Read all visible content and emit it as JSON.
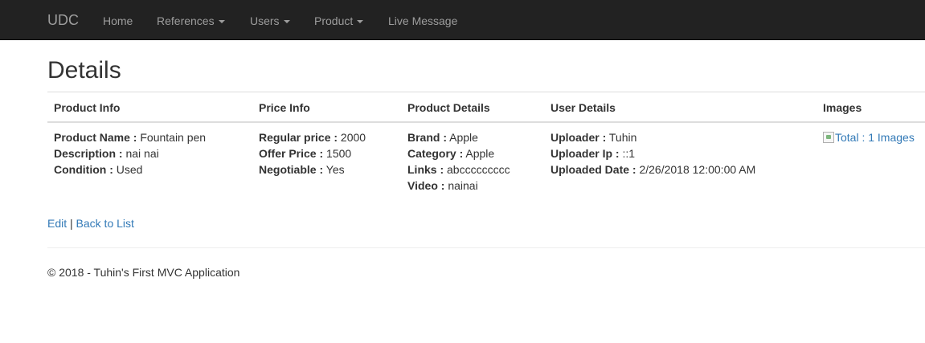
{
  "navbar": {
    "brand": "UDC",
    "items": [
      {
        "label": "Home",
        "dropdown": false
      },
      {
        "label": "References",
        "dropdown": true
      },
      {
        "label": "Users",
        "dropdown": true
      },
      {
        "label": "Product",
        "dropdown": true
      },
      {
        "label": "Live Message",
        "dropdown": false
      }
    ]
  },
  "page": {
    "title": "Details"
  },
  "table": {
    "headers": [
      "Product Info",
      "Price Info",
      "Product Details",
      "User Details",
      "Images"
    ],
    "product_info": [
      {
        "label": "Product Name :",
        "value": "Fountain pen"
      },
      {
        "label": "Description :",
        "value": "nai nai"
      },
      {
        "label": "Condition :",
        "value": "Used"
      }
    ],
    "price_info": [
      {
        "label": "Regular price :",
        "value": "2000"
      },
      {
        "label": "Offer Price :",
        "value": "1500"
      },
      {
        "label": "Negotiable :",
        "value": "Yes"
      }
    ],
    "product_details": [
      {
        "label": "Brand :",
        "value": "Apple"
      },
      {
        "label": "Category :",
        "value": "Apple"
      },
      {
        "label": "Links :",
        "value": "abccccccccc"
      },
      {
        "label": "Video :",
        "value": "nainai"
      }
    ],
    "user_details": [
      {
        "label": "Uploader :",
        "value": "Tuhin"
      },
      {
        "label": "Uploader Ip :",
        "value": "::1"
      },
      {
        "label": "Uploaded Date :",
        "value": "2/26/2018 12:00:00 AM"
      }
    ],
    "images_link": "Total : 1 Images"
  },
  "actions": {
    "edit": "Edit",
    "separator": "|",
    "back": "Back to List"
  },
  "footer": {
    "text": "© 2018 - Tuhin's First MVC Application"
  },
  "colors": {
    "navbar_bg": "#222222",
    "nav_text": "#9d9d9d",
    "link": "#337ab7"
  }
}
